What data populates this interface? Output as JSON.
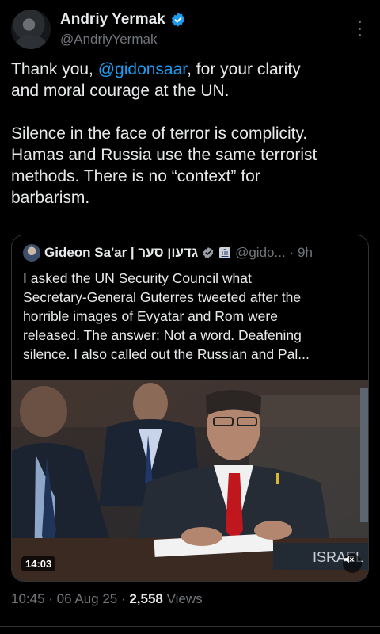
{
  "author": {
    "name": "Andriy Yermak",
    "handle": "@AndriyYermak"
  },
  "tweet": {
    "line1_pre": "Thank you, ",
    "mention": "@gidonsaar",
    "line1_post": ", for your clarity\nand moral courage at the UN.",
    "body": "Silence in the face of terror is complicity.\nHamas and Russia use the same terrorist\nmethods. There is no “context” for\nbarbarism."
  },
  "quote": {
    "name": "Gideon Sa'ar | גדעון סער",
    "handle": "@gido...",
    "time": "· 9h",
    "text": "I asked the UN Security Council what\nSecretary-General Guterres tweeted after the\nhorrible images of Evyatar and Rom were\nreleased. The answer: Not a word. Deafening\nsilence. I also called out the Russian and Pal...",
    "video_duration": "14:03",
    "placard": "ISRAEL"
  },
  "meta": {
    "time": "10:45",
    "date": "06 Aug 25",
    "views": "2,558",
    "views_label": "Views",
    "separator": " · "
  },
  "colors": {
    "accent": "#1d9bf0",
    "muted": "#71767b",
    "text": "#e7e9ea",
    "background": "#000000"
  },
  "icons": {
    "verified": "verified-badge-icon",
    "more": "more-dots-icon",
    "mute": "speaker-muted-icon"
  }
}
